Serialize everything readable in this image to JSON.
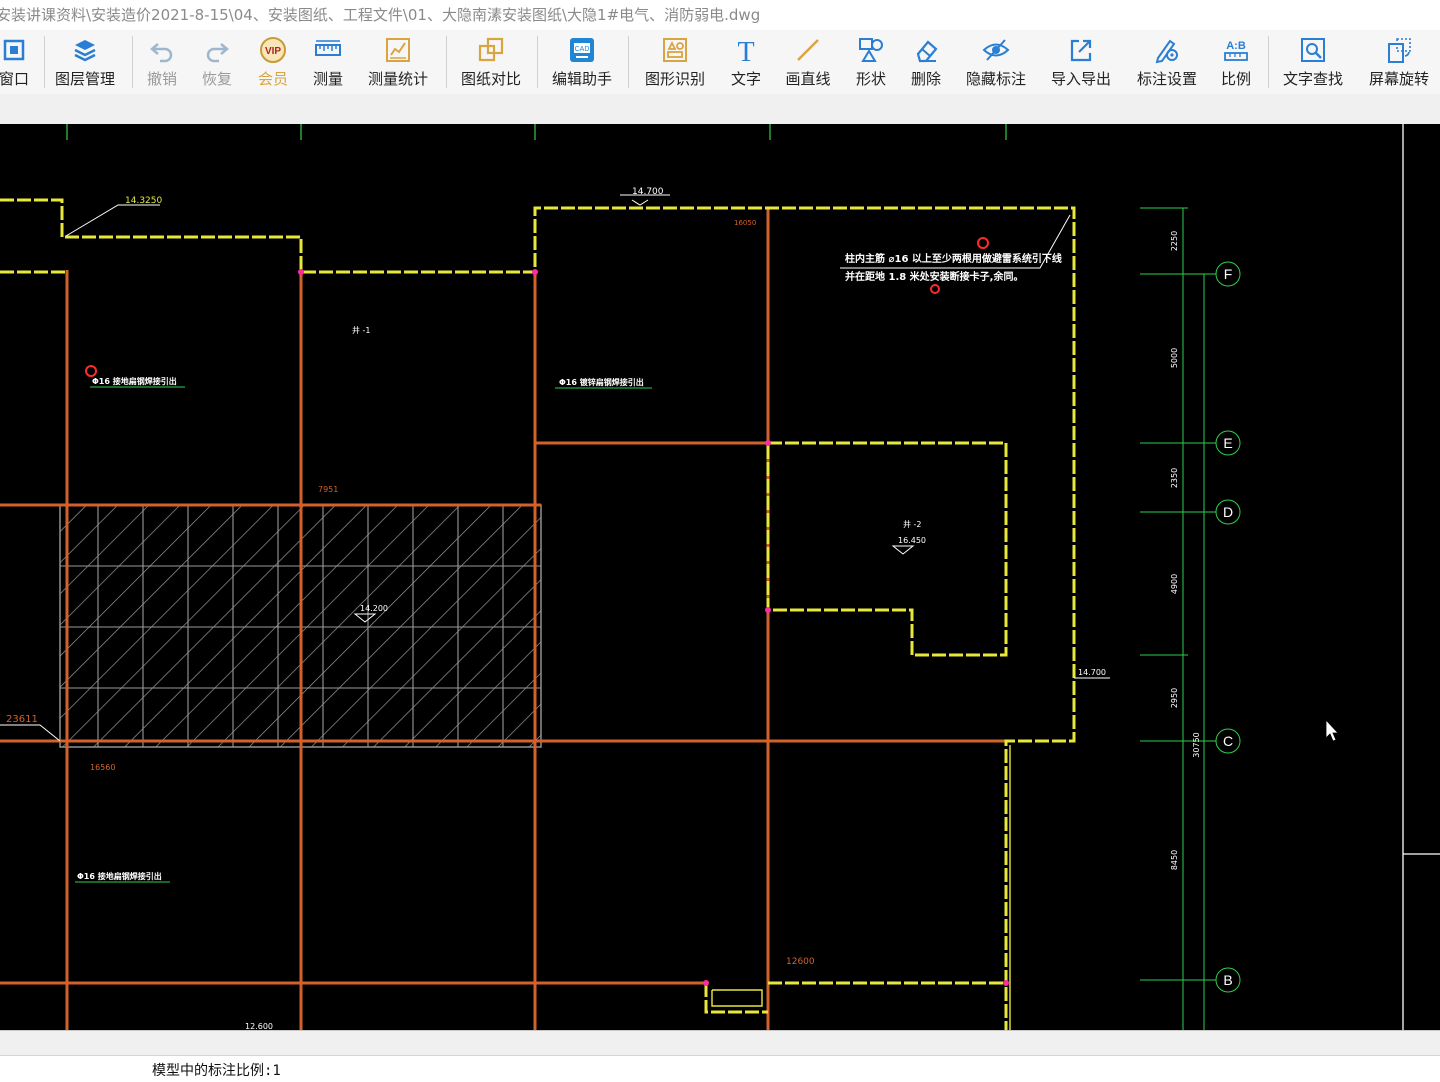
{
  "window": {
    "title": "安装讲课资料\\安装造价2021-8-15\\04、安装图纸、工程文件\\01、大隐南溸安装图纸\\大隐1#电气、消防弱电.dwg"
  },
  "toolbar": {
    "items": [
      {
        "id": "window",
        "label": "窗口",
        "icon": "window-fit-icon"
      },
      {
        "id": "layers",
        "label": "图层管理",
        "icon": "layers-icon"
      },
      {
        "id": "undo",
        "label": "撤销",
        "icon": "undo-icon"
      },
      {
        "id": "redo",
        "label": "恢复",
        "icon": "redo-icon"
      },
      {
        "id": "vip",
        "label": "会员",
        "icon": "vip-badge-icon",
        "badge": "VIP"
      },
      {
        "id": "measure",
        "label": "测量",
        "icon": "ruler-icon"
      },
      {
        "id": "measure-stats",
        "label": "测量统计",
        "icon": "measure-stats-icon"
      },
      {
        "id": "compare",
        "label": "图纸对比",
        "icon": "compare-icon"
      },
      {
        "id": "edit-assistant",
        "label": "编辑助手",
        "icon": "cad-edit-icon",
        "badge": "CAD"
      },
      {
        "id": "shape-recognize",
        "label": "图形识别",
        "icon": "shape-recognize-icon"
      },
      {
        "id": "text",
        "label": "文字",
        "icon": "text-icon",
        "glyph": "T"
      },
      {
        "id": "line",
        "label": "画直线",
        "icon": "line-icon"
      },
      {
        "id": "shape",
        "label": "形状",
        "icon": "shape-icon"
      },
      {
        "id": "delete",
        "label": "删除",
        "icon": "eraser-icon"
      },
      {
        "id": "hide-annot",
        "label": "隐藏标注",
        "icon": "hide-eye-icon"
      },
      {
        "id": "import-export",
        "label": "导入导出",
        "icon": "export-icon"
      },
      {
        "id": "annot-settings",
        "label": "标注设置",
        "icon": "annotation-settings-icon"
      },
      {
        "id": "scale",
        "label": "比例",
        "icon": "scale-icon",
        "glyph": "A:B"
      },
      {
        "id": "text-search",
        "label": "文字查找",
        "icon": "text-search-icon"
      },
      {
        "id": "rotate",
        "label": "屏幕旋转",
        "icon": "rotate-screen-icon"
      }
    ]
  },
  "colors": {
    "yellow": "#e8e83a",
    "orange": "#d2622a",
    "green": "#2fd04a",
    "white": "#ffffff",
    "hatch": "#9a9a9a",
    "magenta": "#ff2aa0",
    "red": "#ff2a2a"
  },
  "drawing": {
    "levels": {
      "l_14_3250": "14.3250",
      "l_14_700_top": "14.700",
      "l_16050": "16050",
      "l_7951": "7951",
      "l_23611": "23611",
      "l_16560": "16560",
      "l_14_700_right": "14.700",
      "l_12600": "12600",
      "l_12_600": "12.600",
      "l_14_200": "14.200",
      "l_16_450": "16.450"
    },
    "room_labels": {
      "room1": "井 -1",
      "room2": "井 -2"
    },
    "notes": {
      "note1_line1": "柱内主筋 ⌀16 以上至少两根用做避雷系统引下线",
      "note1_line2": "并在距地 1.8 米处安装断接卡子,余同。",
      "note2": "Φ16 接地扁钢焊接引出",
      "note3": "Φ16 镀锌扁钢焊接引出",
      "note4": "Φ16 接地扁钢焊接引出"
    },
    "axes": [
      {
        "id": "F",
        "label": "F"
      },
      {
        "id": "E",
        "label": "E"
      },
      {
        "id": "D",
        "label": "D"
      },
      {
        "id": "C",
        "label": "C"
      },
      {
        "id": "B",
        "label": "B"
      }
    ],
    "dimensions": {
      "d1": "2250",
      "d2": "5000",
      "d3": "2350",
      "d4": "4900",
      "d5": "2950",
      "d6": "8450",
      "total": "30750"
    }
  },
  "status": {
    "text": "模型中的标注比例:1"
  }
}
